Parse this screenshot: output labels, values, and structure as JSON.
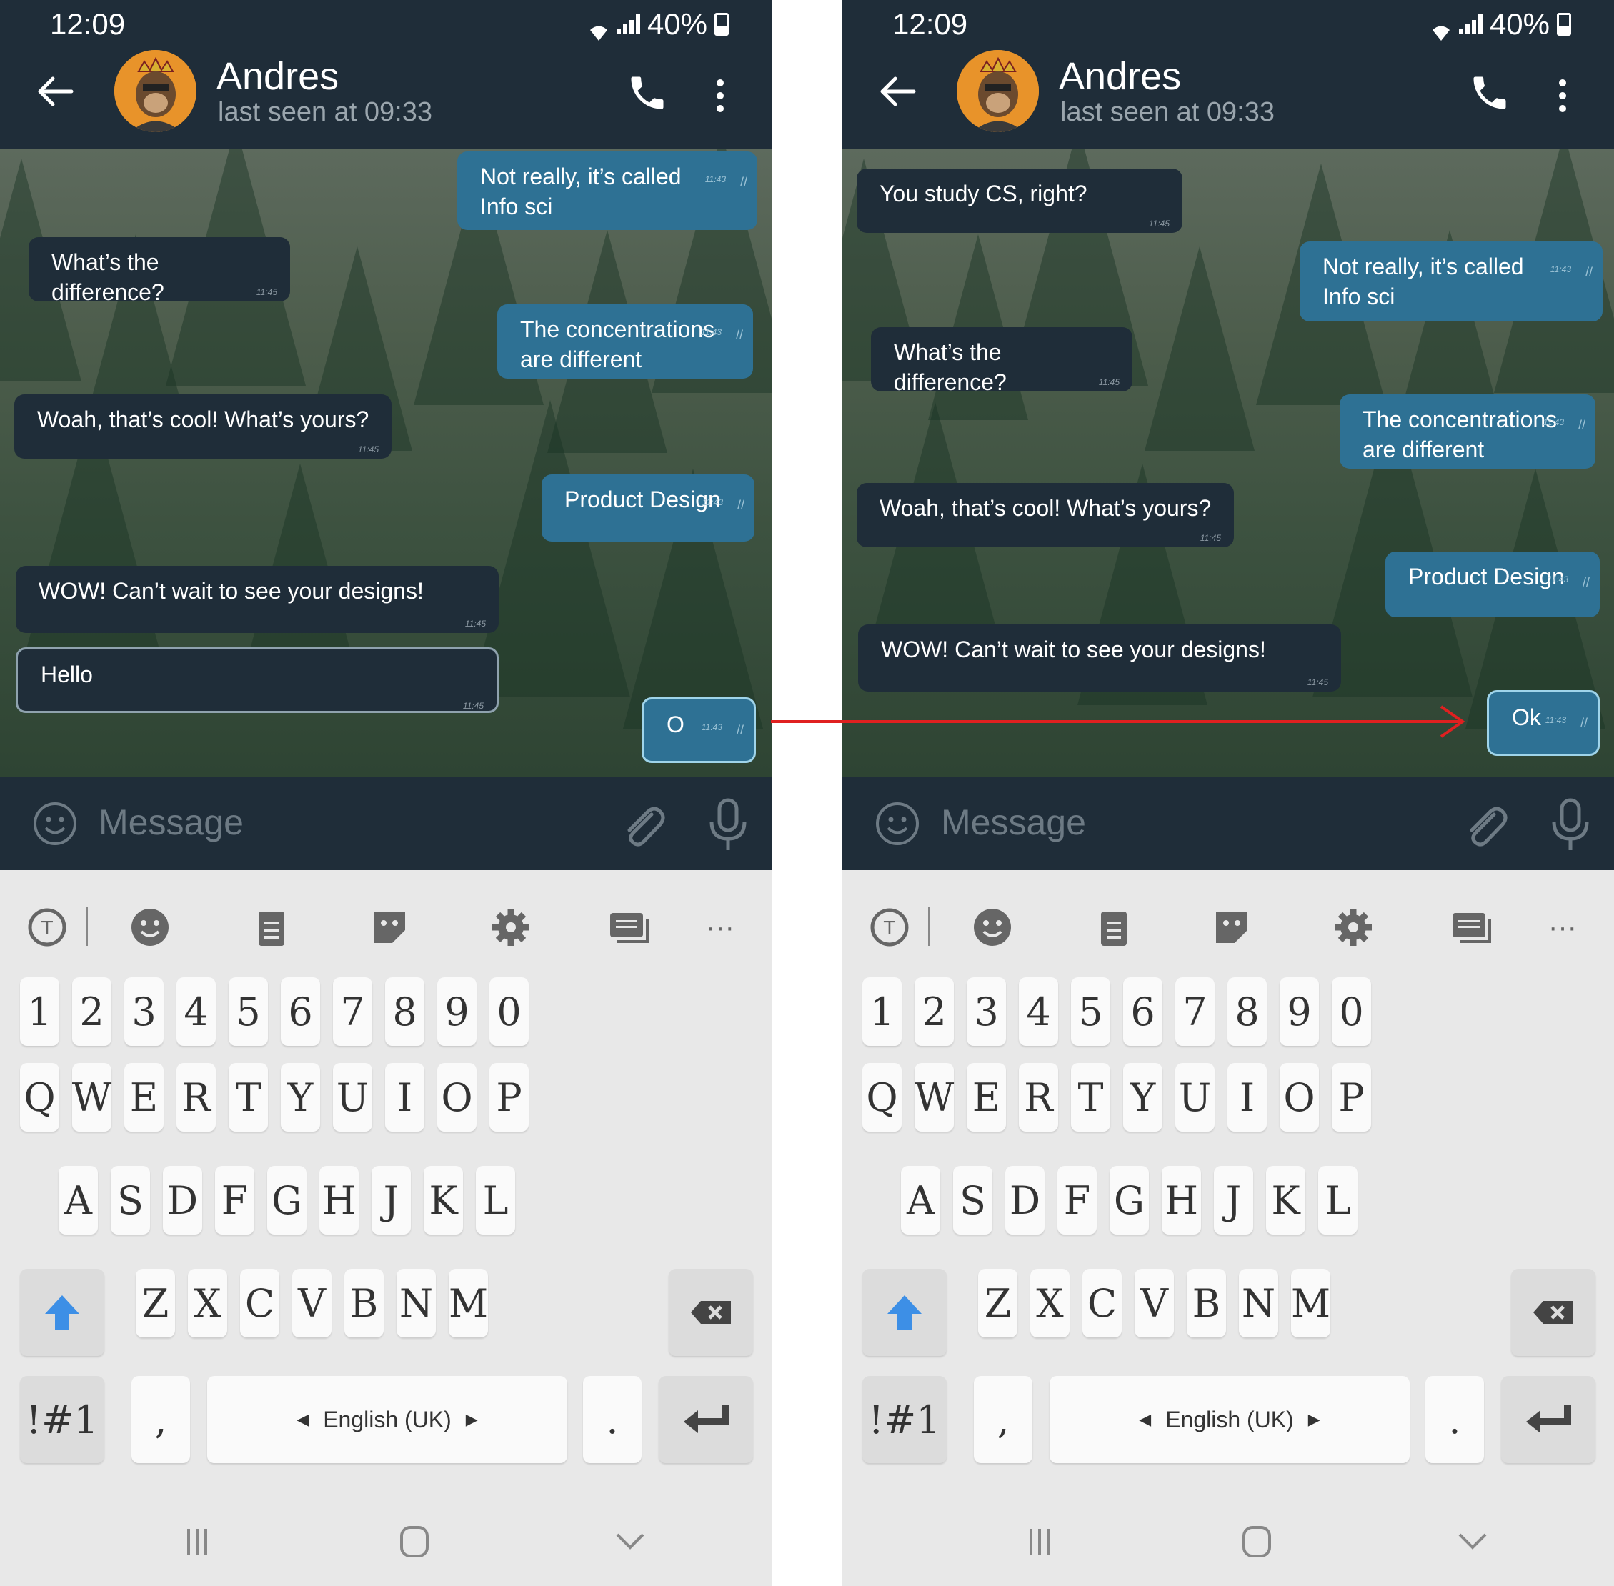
{
  "status": {
    "time": "12:09",
    "battery": "40%"
  },
  "header": {
    "name": "Andres",
    "last_seen": "last seen at 09:33"
  },
  "input": {
    "placeholder": "Message"
  },
  "left_screen": {
    "messages": [
      {
        "dir": "out",
        "text": "Not really, it’s called\nInfo sci",
        "time": "11:43"
      },
      {
        "dir": "in",
        "text": "What’s the difference?",
        "time": "11:45"
      },
      {
        "dir": "out",
        "text": "The concentrations\nare different",
        "time": "11:43"
      },
      {
        "dir": "in",
        "text": "Woah, that’s cool! What’s yours?",
        "time": "11:45"
      },
      {
        "dir": "out",
        "text": "Product Design",
        "time": "11:43"
      },
      {
        "dir": "in",
        "text": "WOW! Can’t wait to see your designs!",
        "time": "11:45"
      },
      {
        "dir": "in",
        "text": "Hello",
        "time": "11:45",
        "highlight": true
      },
      {
        "dir": "out",
        "text": "O",
        "time": "11:43",
        "highlight": true
      }
    ]
  },
  "right_screen": {
    "messages": [
      {
        "dir": "in",
        "text": "You study CS, right?",
        "time": "11:45"
      },
      {
        "dir": "out",
        "text": "Not really, it’s called\nInfo sci",
        "time": "11:43"
      },
      {
        "dir": "in",
        "text": "What’s the difference?",
        "time": "11:45"
      },
      {
        "dir": "out",
        "text": "The concentrations\nare different",
        "time": "11:43"
      },
      {
        "dir": "in",
        "text": "Woah, that’s cool! What’s yours?",
        "time": "11:45"
      },
      {
        "dir": "out",
        "text": "Product Design",
        "time": "11:43"
      },
      {
        "dir": "in",
        "text": "WOW! Can’t wait to see your designs!",
        "time": "11:45"
      },
      {
        "dir": "out",
        "text": "Ok",
        "time": "11:43",
        "highlight": true
      }
    ]
  },
  "keyboard": {
    "toolbar": [
      "translate-icon",
      "emoji-icon",
      "clipboard-icon",
      "sticker-icon",
      "settings-icon",
      "keyboard-icon",
      "more-icon"
    ],
    "more_label": "···",
    "row_numbers": [
      "1",
      "2",
      "3",
      "4",
      "5",
      "6",
      "7",
      "8",
      "9",
      "0"
    ],
    "row1": [
      "Q",
      "W",
      "E",
      "R",
      "T",
      "Y",
      "U",
      "I",
      "O",
      "P"
    ],
    "row2": [
      "A",
      "S",
      "D",
      "F",
      "G",
      "H",
      "J",
      "K",
      "L"
    ],
    "row3": [
      "Z",
      "X",
      "C",
      "V",
      "B",
      "N",
      "M"
    ],
    "symbols": "!#1",
    "comma": ",",
    "space": "English (UK)",
    "period": "."
  },
  "colors": {
    "header": "#1f2d39",
    "outgoing": "#2e7194",
    "incoming": "#1f2d39",
    "arrow": "#e02020",
    "shift": "#3d8fe6"
  }
}
